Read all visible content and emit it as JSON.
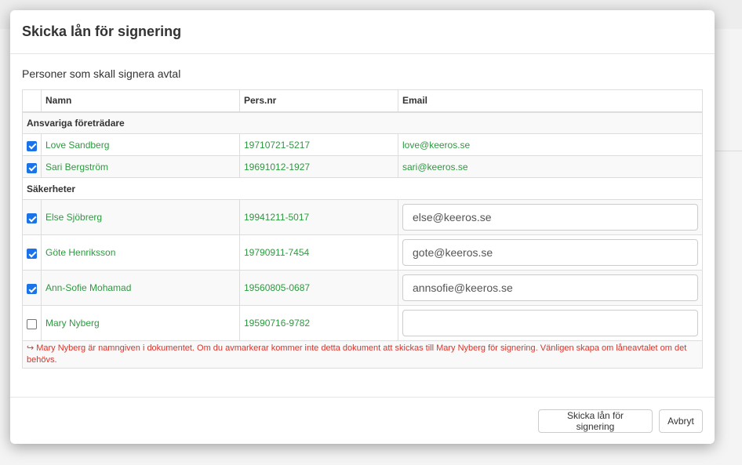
{
  "modal": {
    "title": "Skicka lån för signering",
    "subtitle": "Personer som skall signera avtal"
  },
  "table": {
    "headers": {
      "name": "Namn",
      "pnr": "Pers.nr",
      "email": "Email"
    },
    "groups": [
      {
        "label": "Ansvariga företrädare",
        "rows": [
          {
            "checked": true,
            "name": "Love Sandberg",
            "pnr": "19710721-5217",
            "email": "love@keeros.se"
          },
          {
            "checked": true,
            "name": "Sari Bergström",
            "pnr": "19691012-1927",
            "email": "sari@keeros.se"
          }
        ]
      },
      {
        "label": "Säkerheter",
        "rows": [
          {
            "checked": true,
            "name": "Else Sjöbrerg",
            "pnr": "19941211-5017",
            "email_value": "else@keeros.se"
          },
          {
            "checked": true,
            "name": "Göte Henriksson",
            "pnr": "19790911-7454",
            "email_value": "gote@keeros.se"
          },
          {
            "checked": true,
            "name": "Ann-Sofie Mohamad",
            "pnr": "19560805-0687",
            "email_value": "annsofie@keeros.se"
          },
          {
            "checked": false,
            "name": "Mary Nyberg",
            "pnr": "19590716-9782",
            "email_value": ""
          }
        ]
      }
    ],
    "warning": "Mary Nyberg är namngiven i dokumentet. Om du avmarkerar kommer inte detta dokument att skickas till Mary Nyberg för signering. Vänligen skapa om låneavtalet om det behövs.",
    "warning_icon": "arrow-return-icon"
  },
  "footer": {
    "send_label": "Skicka lån för signering",
    "cancel_label": "Avbryt"
  },
  "colors": {
    "accent_text": "#2c9a3f",
    "checkbox": "#1a73e8",
    "warning": "#d9342b"
  }
}
